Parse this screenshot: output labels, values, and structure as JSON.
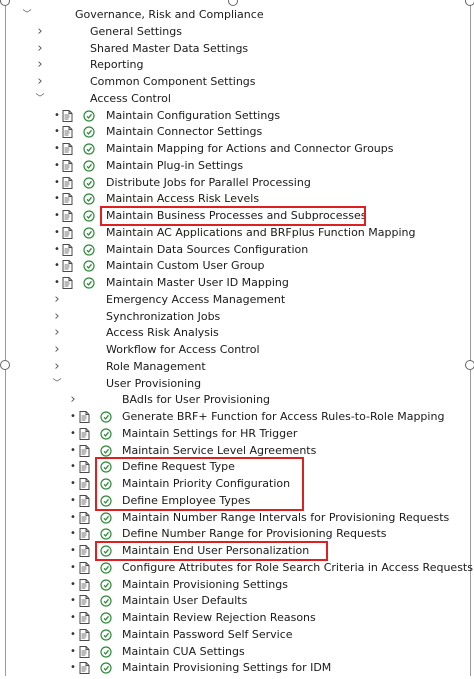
{
  "tree": [
    {
      "label": "Governance, Risk and Compliance",
      "expander": "open",
      "level": 0,
      "icons": false
    },
    {
      "label": "General Settings",
      "expander": "closed",
      "level": 1,
      "icons": false
    },
    {
      "label": "Shared Master Data Settings",
      "expander": "closed",
      "level": 1,
      "icons": false
    },
    {
      "label": "Reporting",
      "expander": "closed",
      "level": 1,
      "icons": false
    },
    {
      "label": "Common Component Settings",
      "expander": "closed",
      "level": 1,
      "icons": false
    },
    {
      "label": "Access Control",
      "expander": "open",
      "level": 1,
      "icons": false
    },
    {
      "label": "Maintain Configuration Settings",
      "level": 2,
      "icons": true
    },
    {
      "label": "Maintain Connector Settings",
      "level": 2,
      "icons": true
    },
    {
      "label": "Maintain Mapping for Actions and Connector Groups",
      "level": 2,
      "icons": true
    },
    {
      "label": "Maintain Plug-in Settings",
      "level": 2,
      "icons": true
    },
    {
      "label": "Distribute Jobs for Parallel Processing",
      "level": 2,
      "icons": true
    },
    {
      "label": "Maintain Access Risk Levels",
      "level": 2,
      "icons": true
    },
    {
      "label": "Maintain Business Processes and Subprocesses",
      "level": 2,
      "icons": true
    },
    {
      "label": "Maintain AC Applications and BRFplus Function Mapping",
      "level": 2,
      "icons": true
    },
    {
      "label": "Maintain Data Sources Configuration",
      "level": 2,
      "icons": true
    },
    {
      "label": "Maintain Custom User Group",
      "level": 2,
      "icons": true
    },
    {
      "label": "Maintain Master User ID Mapping",
      "level": 2,
      "icons": true
    },
    {
      "label": "Emergency Access Management",
      "expander": "closed",
      "level": 2,
      "icons": false
    },
    {
      "label": "Synchronization Jobs",
      "expander": "closed",
      "level": 2,
      "icons": false
    },
    {
      "label": "Access Risk Analysis",
      "expander": "closed",
      "level": 2,
      "icons": false
    },
    {
      "label": "Workflow for Access Control",
      "expander": "closed",
      "level": 2,
      "icons": false
    },
    {
      "label": "Role Management",
      "expander": "closed",
      "level": 2,
      "icons": false
    },
    {
      "label": "User Provisioning",
      "expander": "open",
      "level": 2,
      "icons": false
    },
    {
      "label": "BAdIs for User Provisioning",
      "expander": "closed",
      "level": 3,
      "icons": false
    },
    {
      "label": "Generate BRF+ Function for Access Rules-to-Role Mapping",
      "level": 3,
      "icons": true
    },
    {
      "label": "Maintain Settings for HR Trigger",
      "level": 3,
      "icons": true
    },
    {
      "label": "Maintain Service Level Agreements",
      "level": 3,
      "icons": true
    },
    {
      "label": "Define Request  Type",
      "level": 3,
      "icons": true
    },
    {
      "label": "Maintain Priority Configuration",
      "level": 3,
      "icons": true
    },
    {
      "label": "Define Employee Types",
      "level": 3,
      "icons": true
    },
    {
      "label": "Maintain Number Range Intervals for Provisioning Requests",
      "level": 3,
      "icons": true
    },
    {
      "label": "Define Number Range for Provisioning Requests",
      "level": 3,
      "icons": true
    },
    {
      "label": "Maintain End User Personalization",
      "level": 3,
      "icons": true
    },
    {
      "label": "Configure Attributes for Role Search Criteria in Access Requests",
      "level": 3,
      "icons": true
    },
    {
      "label": "Maintain Provisioning Settings",
      "level": 3,
      "icons": true
    },
    {
      "label": "Maintain User Defaults",
      "level": 3,
      "icons": true
    },
    {
      "label": "Maintain Review Rejection Reasons",
      "level": 3,
      "icons": true
    },
    {
      "label": "Maintain Password Self Service",
      "level": 3,
      "icons": true
    },
    {
      "label": "Maintain CUA Settings",
      "level": 3,
      "icons": true
    },
    {
      "label": "Maintain Provisioning Settings for IDM",
      "level": 3,
      "icons": true
    }
  ],
  "highlight_groups": [
    {
      "rows": [
        12,
        12
      ]
    },
    {
      "rows": [
        27,
        29
      ]
    },
    {
      "rows": [
        32,
        32
      ]
    }
  ],
  "colors": {
    "highlight": "#e02020",
    "exec_icon": "#2e8b3a",
    "doc_icon": "#4a4a4a"
  },
  "icons": {
    "expanded": "chevron-down-icon",
    "collapsed": "chevron-right-icon",
    "bullet": "bullet-dot-icon",
    "doc": "documentation-icon",
    "exec": "execute-activity-icon"
  }
}
